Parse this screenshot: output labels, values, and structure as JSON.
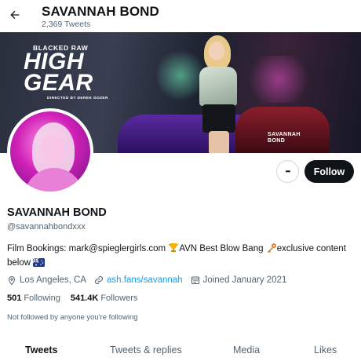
{
  "header": {
    "title": "SAVANNAH BOND",
    "tweet_count": "2,369 Tweets",
    "back_icon": "arrow-left-icon"
  },
  "banner": {
    "brand_top": "BLACKED RAW",
    "brand_title_line1": "HIGH",
    "brand_title_line2": "GEAR",
    "brand_director": "DIRECTED BY DEREK DOZER",
    "brand_name_line1": "SAVANNAH",
    "brand_name_line2": "BOND"
  },
  "actions": {
    "more_label": "•••",
    "follow_label": "Follow"
  },
  "profile": {
    "display_name": "SAVANNAH BOND",
    "handle": "@savannahbondxxx",
    "bio_part1": "Film Bookings: mark@spieglergirls.com ",
    "bio_part2": "AVN Best Blow Bang ",
    "bio_part3": "exclusive content below "
  },
  "meta": {
    "location": "Los Angeles, CA",
    "link": "ash.fans/savannah",
    "joined": "Joined January 2021"
  },
  "counts": {
    "following_num": "501",
    "following_label": "Following",
    "followers_num": "541.4K",
    "followers_label": "Followers"
  },
  "not_followed": "Not followed by anyone you're following",
  "tabs": {
    "tweets": "Tweets",
    "replies": "Tweets & replies",
    "media": "Media",
    "likes": "Likes"
  },
  "colors": {
    "text": "#0f1419",
    "secondary": "#536471",
    "link": "#1d9bf0",
    "follow_bg": "#0f1419"
  }
}
